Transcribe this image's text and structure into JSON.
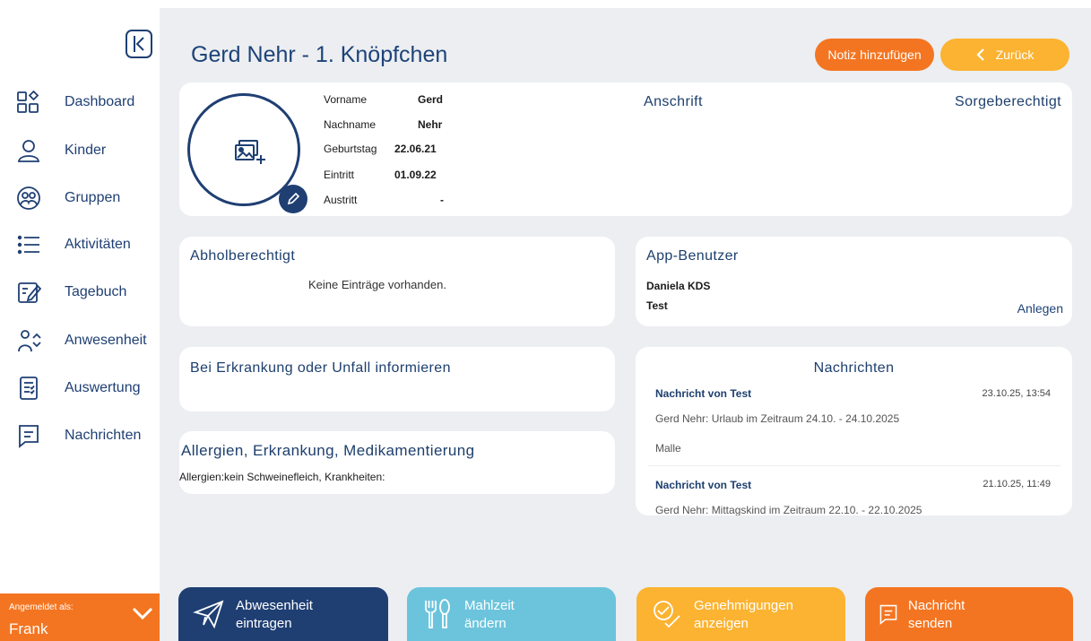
{
  "sidebar": {
    "items": [
      {
        "label": "Dashboard",
        "icon": "dashboard-icon"
      },
      {
        "label": "Kinder",
        "icon": "person-icon"
      },
      {
        "label": "Gruppen",
        "icon": "group-icon"
      },
      {
        "label": "Aktivitäten",
        "icon": "list-icon"
      },
      {
        "label": "Tagebuch",
        "icon": "edit-note-icon"
      },
      {
        "label": "Anwesenheit",
        "icon": "attendance-icon"
      },
      {
        "label": "Auswertung",
        "icon": "report-icon"
      },
      {
        "label": "Nachrichten",
        "icon": "message-icon"
      }
    ],
    "login": {
      "caption": "Angemeldet als:",
      "user": "Frank"
    }
  },
  "header": {
    "title": "Gerd Nehr - 1. Knöpfchen",
    "note_button": "Notiz hinzufügen",
    "back_button": "Zurück"
  },
  "profile": {
    "rows": [
      {
        "label": "Vorname",
        "value": "Gerd"
      },
      {
        "label": "Nachname",
        "value": "Nehr"
      },
      {
        "label": "Geburtstag",
        "value": "22.06.21"
      },
      {
        "label": "Eintritt",
        "value": "01.09.22"
      },
      {
        "label": "Austritt",
        "value": "-"
      }
    ],
    "address_title": "Anschrift",
    "guardian_title": "Sorgeberechtigt"
  },
  "pickup": {
    "title": "Abholberechtigt",
    "empty_text": "Keine Einträge vorhanden."
  },
  "app_users": {
    "title": "App-Benutzer",
    "users": [
      "Daniela KDS",
      "Test"
    ],
    "create_link": "Anlegen"
  },
  "emergency": {
    "title": "Bei Erkrankung oder Unfall informieren"
  },
  "allergies": {
    "title": "Allergien, Erkrankung, Medikamentierung",
    "text": "Allergien:kein Schweinefleich, Krankheiten:"
  },
  "messages": {
    "title": "Nachrichten",
    "items": [
      {
        "sender": "Nachricht von Test",
        "time": "23.10.25, 13:54",
        "line1": "Gerd Nehr: Urlaub im Zeitraum 24.10. - 24.10.2025",
        "line2": "Malle"
      },
      {
        "sender": "Nachricht von Test",
        "time": "21.10.25, 11:49",
        "line1": "Gerd Nehr: Mittagskind im Zeitraum 22.10. - 22.10.2025",
        "line2": ""
      }
    ]
  },
  "bottom_actions": [
    {
      "line1": "Abwesenheit",
      "line2": "eintragen",
      "color": "#1f3f73",
      "icon": "paper-plane-icon"
    },
    {
      "line1": "Mahlzeit",
      "line2": "ändern",
      "color": "#6cc4dc",
      "icon": "cutlery-icon"
    },
    {
      "line1": "Genehmigungen",
      "line2": "anzeigen",
      "color": "#fbb331",
      "icon": "approval-icon"
    },
    {
      "line1": "Nachricht",
      "line2": "senden",
      "color": "#f47521",
      "icon": "message-icon"
    }
  ],
  "colors": {
    "navy": "#1f3f73",
    "orange": "#f47521",
    "yellow": "#fbb331",
    "teal": "#6cc4dc",
    "background": "#eceef1"
  }
}
